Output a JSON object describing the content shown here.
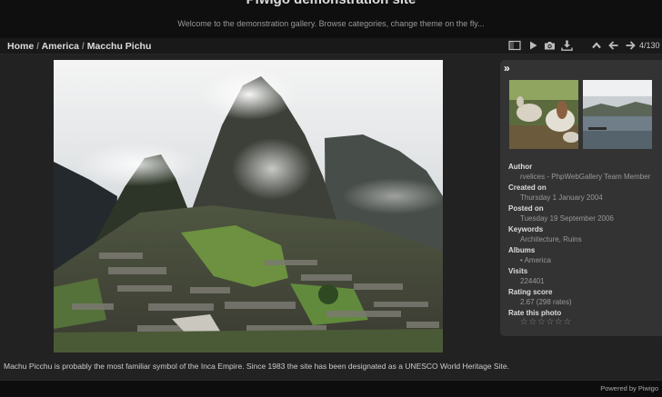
{
  "header": {
    "title": "Piwigo demonstration site",
    "subtitle": "Welcome to the demonstration gallery. Browse categories, change theme on the fly..."
  },
  "breadcrumb": {
    "home": "Home",
    "sep1": " / ",
    "category": "America",
    "sep2": " / ",
    "current": "Macchu Pichu"
  },
  "toolbar": {
    "icons": [
      "show-file-metadata-icon",
      "slideshow-icon",
      "camera-icon",
      "download-icon",
      "up-icon",
      "previous-icon",
      "next-icon"
    ],
    "counter": "4/130"
  },
  "photo": {
    "caption": "Machu Picchu is probably the most familiar symbol of the Inca Empire. Since 1983 the site has been designated as a UNESCO World Heritage Site."
  },
  "sidebar": {
    "toggle": "»",
    "fields": [
      {
        "label": "Author",
        "values": [
          "rvelices - PhpWebGallery Team Member"
        ]
      },
      {
        "label": "Created on",
        "values": [
          "Thursday 1 January 2004"
        ]
      },
      {
        "label": "Posted on",
        "values": [
          "Tuesday 19 September 2006"
        ]
      },
      {
        "label": "Keywords",
        "values": [
          "Architecture, Ruins"
        ]
      },
      {
        "label": "Albums",
        "values": [
          "• America"
        ]
      },
      {
        "label": "Visits",
        "values": [
          "224401"
        ]
      },
      {
        "label": "Rating score",
        "values": [
          "2.67 (298 rates)"
        ]
      },
      {
        "label": "Rate this photo",
        "values": []
      }
    ],
    "rating": {
      "max": 6,
      "icon": "star-outline-icon"
    }
  },
  "footer": {
    "powered": "Powered by Piwigo"
  },
  "colors": {
    "background": "#222222",
    "header": "#0f0f0f",
    "sidebar": "#333333",
    "text": "#dddddd"
  }
}
